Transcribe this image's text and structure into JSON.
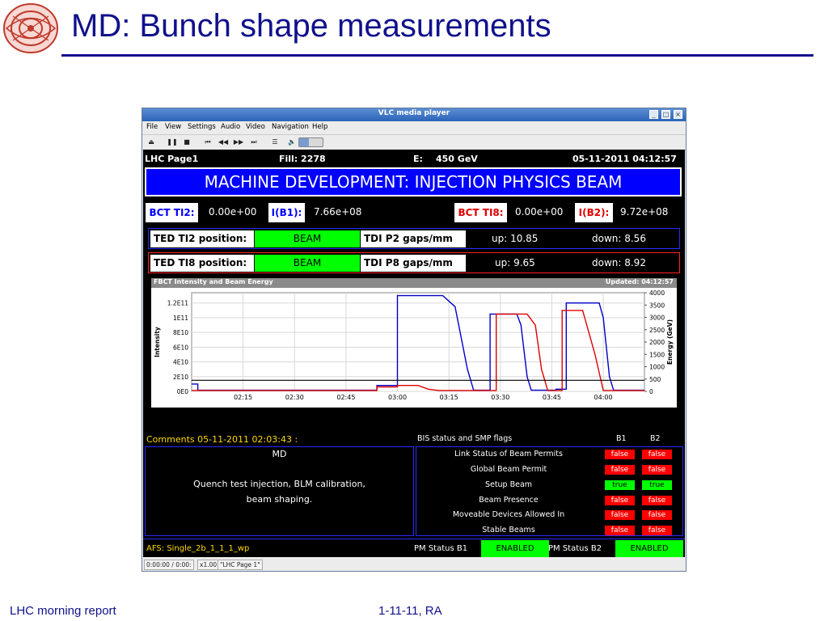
{
  "slide": {
    "title": "MD: Bunch shape measurements",
    "footer_left": "LHC morning report",
    "footer_mid": "1-11-11, RA"
  },
  "vlc": {
    "title": "VLC media player",
    "menu": [
      "File",
      "View",
      "Settings",
      "Audio",
      "Video",
      "Navigation",
      "Help"
    ],
    "toolbar_icons": [
      "eject-icon",
      "pause-icon",
      "stop-icon",
      "previous-icon",
      "rewind-icon",
      "fast-forward-icon",
      "next-icon",
      "playlist-icon",
      "volume-icon"
    ],
    "status": {
      "time": "0:00:00 / 0:00:",
      "speed": "x1.00",
      "playing": "\"LHC Page 1\""
    },
    "volume_level": 0.4
  },
  "lhc": {
    "page": "LHC Page1",
    "fill": "Fill: 2278",
    "energy_label": "E:",
    "energy": "450 GeV",
    "datetime": "05-11-2011 04:12:57",
    "banner": "MACHINE DEVELOPMENT: INJECTION PHYSICS BEAM",
    "bct_ti2_label": "BCT TI2:",
    "bct_ti2_value": "0.00e+00",
    "ib1_label": "I(B1):",
    "ib1_value": "7.66e+08",
    "bct_ti8_label": "BCT TI8:",
    "bct_ti8_value": "0.00e+00",
    "ib2_label": "I(B2):",
    "ib2_value": "9.72e+08",
    "ted_rows": [
      {
        "label": "TED TI2 position:",
        "state": "BEAM",
        "tdi_label": "TDI P2 gaps/mm",
        "up": "up:  10.85",
        "down": "down:   8.56"
      },
      {
        "label": "TED TI8 position:",
        "state": "BEAM",
        "tdi_label": "TDI P8 gaps/mm",
        "up": "up:   9.65",
        "down": "down:   8.92"
      }
    ],
    "comments_header": "Comments 05-11-2011 02:03:43 :",
    "comment_title": "MD",
    "comment_line1": "Quench test injection, BLM calibration,",
    "comment_line2": "beam shaping.",
    "bis_header": "BIS status and SMP flags",
    "b1": "B1",
    "b2": "B2",
    "flags": [
      {
        "label": "Link Status of Beam Permits",
        "b1": "false",
        "b2": "false"
      },
      {
        "label": "Global Beam Permit",
        "b1": "false",
        "b2": "false"
      },
      {
        "label": "Setup Beam",
        "b1": "true",
        "b2": "true"
      },
      {
        "label": "Beam Presence",
        "b1": "false",
        "b2": "false"
      },
      {
        "label": "Moveable Devices Allowed In",
        "b1": "false",
        "b2": "false"
      },
      {
        "label": "Stable Beams",
        "b1": "false",
        "b2": "false"
      }
    ],
    "afs": "AFS: Single_2b_1_1_1_wp",
    "pm_b1_label": "PM Status B1",
    "pm_b1": "ENABLED",
    "pm_b2_label": "PM Status B2",
    "pm_b2": "ENABLED",
    "colors": {
      "banner": "#0000ff",
      "true": "#00ff00",
      "false": "#ff0000",
      "comments": "#ffd700",
      "b1_line": "#0000c8",
      "b2_line": "#e00000"
    }
  },
  "chart_data": {
    "type": "line",
    "title": "FBCT Intensity and Beam Energy",
    "updated": "Updated: 04:12:57",
    "ylabel": "Intensity",
    "y2label": "Energy (GeV)",
    "x_ticks": [
      "02:15",
      "02:30",
      "02:45",
      "03:00",
      "03:15",
      "03:30",
      "03:45",
      "04:00"
    ],
    "y_ticks": [
      "0E0",
      "2E10",
      "4E10",
      "6E10",
      "8E10",
      "1E11",
      "1.2E11"
    ],
    "y2_ticks": [
      "0",
      "500",
      "1000",
      "1500",
      "2000",
      "2500",
      "3000",
      "3500",
      "4000"
    ],
    "xlim": [
      2.0,
      4.2
    ],
    "ylim": [
      0,
      134000000000.0
    ],
    "y2lim": [
      0,
      4000
    ],
    "series": [
      {
        "color": "#0000c8",
        "points": [
          [
            2.0,
            10000000000.0
          ],
          [
            2.03,
            10000000000.0
          ],
          [
            2.03,
            1500000000.0
          ],
          [
            2.9,
            1500000000.0
          ],
          [
            2.9,
            8000000000.0
          ],
          [
            3.0,
            8000000000.0
          ],
          [
            3.0,
            130000000000.0
          ],
          [
            3.22,
            130000000000.0
          ],
          [
            3.28,
            115000000000.0
          ],
          [
            3.34,
            30000000000.0
          ],
          [
            3.37,
            1500000000.0
          ],
          [
            3.45,
            1500000000.0
          ],
          [
            3.45,
            105000000000.0
          ],
          [
            3.58,
            105000000000.0
          ],
          [
            3.6,
            90000000000.0
          ],
          [
            3.63,
            20000000000.0
          ],
          [
            3.65,
            1500000000.0
          ],
          [
            3.77,
            1500000000.0
          ],
          [
            3.77,
            3000000000.0
          ],
          [
            3.82,
            3000000000.0
          ],
          [
            3.82,
            120000000000.0
          ],
          [
            3.98,
            120000000000.0
          ],
          [
            4.0,
            100000000000.0
          ],
          [
            4.03,
            20000000000.0
          ],
          [
            4.05,
            1500000000.0
          ],
          [
            4.2,
            1500000000.0
          ]
        ]
      },
      {
        "color": "#e00000",
        "points": [
          [
            2.0,
            1200000000.0
          ],
          [
            2.9,
            1200000000.0
          ],
          [
            2.9,
            6000000000.0
          ],
          [
            3.0,
            6000000000.0
          ],
          [
            3.0,
            8000000000.0
          ],
          [
            3.1,
            8000000000.0
          ],
          [
            3.15,
            3000000000.0
          ],
          [
            3.2,
            1200000000.0
          ],
          [
            3.48,
            1200000000.0
          ],
          [
            3.48,
            105000000000.0
          ],
          [
            3.63,
            105000000000.0
          ],
          [
            3.67,
            90000000000.0
          ],
          [
            3.7,
            30000000000.0
          ],
          [
            3.73,
            1200000000.0
          ],
          [
            3.8,
            1200000000.0
          ],
          [
            3.8,
            110000000000.0
          ],
          [
            3.9,
            110000000000.0
          ],
          [
            3.96,
            50000000000.0
          ],
          [
            4.0,
            1200000000.0
          ],
          [
            4.2,
            1200000000.0
          ]
        ]
      },
      {
        "color": "#000000",
        "points": [
          [
            2.0,
            450
          ],
          [
            4.2,
            450
          ]
        ],
        "axis": "y2"
      }
    ]
  }
}
